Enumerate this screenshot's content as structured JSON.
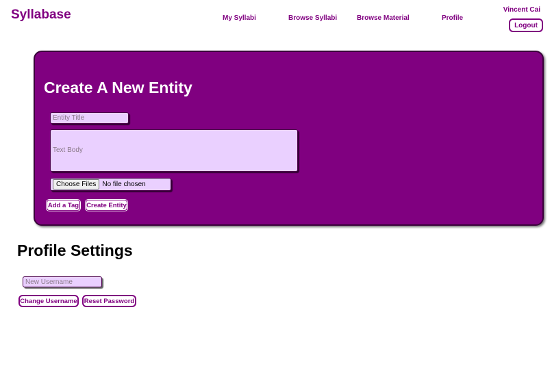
{
  "header": {
    "brand": "Syllabase",
    "nav": [
      {
        "label": "My Syllabi"
      },
      {
        "label": "Browse Syllabi"
      },
      {
        "label": "Browse Material"
      },
      {
        "label": "Profile"
      }
    ],
    "user_name": "Vincent Cai",
    "logout_label": "Logout"
  },
  "entity_form": {
    "title": "Create A New Entity",
    "title_placeholder": "Entity Title",
    "body_placeholder": "Text Body",
    "choose_files_label": "Choose Files",
    "file_status": "No file chosen",
    "add_tag_label": "Add a Tag",
    "create_label": "Create Entity"
  },
  "profile_settings": {
    "title": "Profile Settings",
    "username_placeholder": "New Username",
    "change_username_label": "Change Username",
    "reset_password_label": "Reset Password"
  },
  "colors": {
    "accent": "#800080",
    "input_bg": "#ead0ff"
  }
}
